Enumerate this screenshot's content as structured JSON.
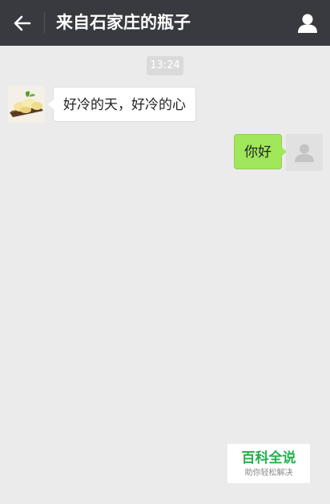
{
  "header": {
    "title": "来自石家庄的瓶子",
    "back_icon": "arrow-left-icon",
    "profile_icon": "person-icon"
  },
  "chat": {
    "timestamp": "13:24",
    "messages": [
      {
        "side": "left",
        "text": "好冷的天，好冷的心",
        "avatar": "food-photo"
      },
      {
        "side": "right",
        "text": "你好",
        "avatar": "default-user-silhouette"
      }
    ]
  },
  "watermark": {
    "name": "百科全说",
    "tagline": "助你轻松解决"
  },
  "colors": {
    "header_bg": "#393a3f",
    "chat_bg": "#ebebeb",
    "sent_bubble": "#a0e75a",
    "received_bubble": "#ffffff",
    "watermark_green": "#22b14c"
  }
}
